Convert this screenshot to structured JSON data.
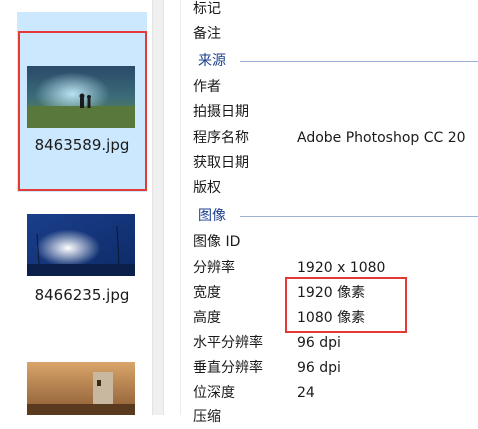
{
  "files": [
    {
      "name": "8463589.jpg",
      "thumb": "night-sky-couple",
      "selected": true
    },
    {
      "name": "8466235.jpg",
      "thumb": "blue-sky-sun"
    },
    {
      "name": "",
      "thumb": "lighthouse-sunset"
    }
  ],
  "details": {
    "top_rows": [
      {
        "label": "标记",
        "value": ""
      },
      {
        "label": "备注",
        "value": ""
      }
    ],
    "origin_section": "来源",
    "origin_rows": [
      {
        "label": "作者",
        "value": ""
      },
      {
        "label": "拍摄日期",
        "value": ""
      },
      {
        "label": "程序名称",
        "value": "Adobe Photoshop CC 20"
      },
      {
        "label": "获取日期",
        "value": ""
      },
      {
        "label": "版权",
        "value": ""
      }
    ],
    "image_section": "图像",
    "image_rows": [
      {
        "label": "图像 ID",
        "value": ""
      },
      {
        "label": "分辨率",
        "value": "1920 x 1080"
      },
      {
        "label": "宽度",
        "value": "1920 像素"
      },
      {
        "label": "高度",
        "value": "1080 像素"
      },
      {
        "label": "水平分辨率",
        "value": "96 dpi"
      },
      {
        "label": "垂直分辨率",
        "value": "96 dpi"
      },
      {
        "label": "位深度",
        "value": "24"
      },
      {
        "label": "压缩",
        "value": ""
      }
    ]
  },
  "colors": {
    "highlight": "#e53935",
    "section_text": "#1b3f8c",
    "selection": "#cce8ff"
  }
}
